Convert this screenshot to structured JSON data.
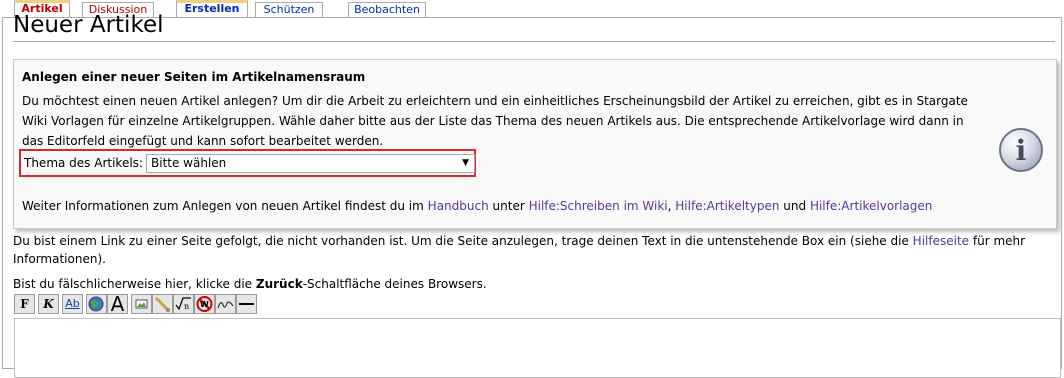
{
  "tabs": [
    {
      "label": "Artikel"
    },
    {
      "label": "Diskussion"
    },
    {
      "label": "Erstellen"
    },
    {
      "label": "Schützen"
    },
    {
      "label": "Beobachten"
    }
  ],
  "page_title": "Neuer Artikel",
  "infobox": {
    "heading": "Anlegen einer neuer Seiten im Artikelnamensraum",
    "text": "Du möchtest einen neuen Artikel anlegen? Um dir die Arbeit zu erleichtern und ein einheitliches Erscheinungsbild der Artikel zu erreichen, gibt es in Stargate Wiki Vorlagen für einzelne Artikelgruppen. Wähle daher bitte aus der Liste das Thema des neuen Artikels aus. Die entsprechende Artikelvorlage wird dann in das Editorfeld eingefügt und kann sofort bearbeitet werden.",
    "select_label": "Thema des Artikels:",
    "select_value": "Bitte wählen",
    "more_prefix": "Weiter Informationen zum Anlegen von neuen Artikel findest du im",
    "link_handbuch": "Handbuch",
    "more_unter": "unter",
    "link_schreiben": "Hilfe:Schreiben im Wiki",
    "comma": ",",
    "link_artikeltypen": "Hilfe:Artikeltypen",
    "more_und": "und",
    "link_artikelvorlagen": "Hilfe:Artikelvorlagen",
    "icon": "info-icon"
  },
  "body": {
    "p1_a": "Du bist einem Link zu einer Seite gefolgt, die nicht vorhanden ist. Um die Seite anzulegen, trage deinen Text in die untenstehende Box ein (siehe die",
    "p1_link": "Hilfeseite",
    "p1_b": "für mehr Informationen).",
    "p2_a": "Bist du fälschlicherweise hier, klicke die",
    "p2_bold": "Zurück",
    "p2_b": "-Schaltfläche deines Browsers."
  },
  "toolbar": {
    "bold": "F",
    "italic": "K",
    "link": "Ab",
    "headline": "A"
  },
  "colors": {
    "highlight_border": "#e0262d",
    "link": "#5a3696",
    "tab_active_top": "#f0d080"
  }
}
